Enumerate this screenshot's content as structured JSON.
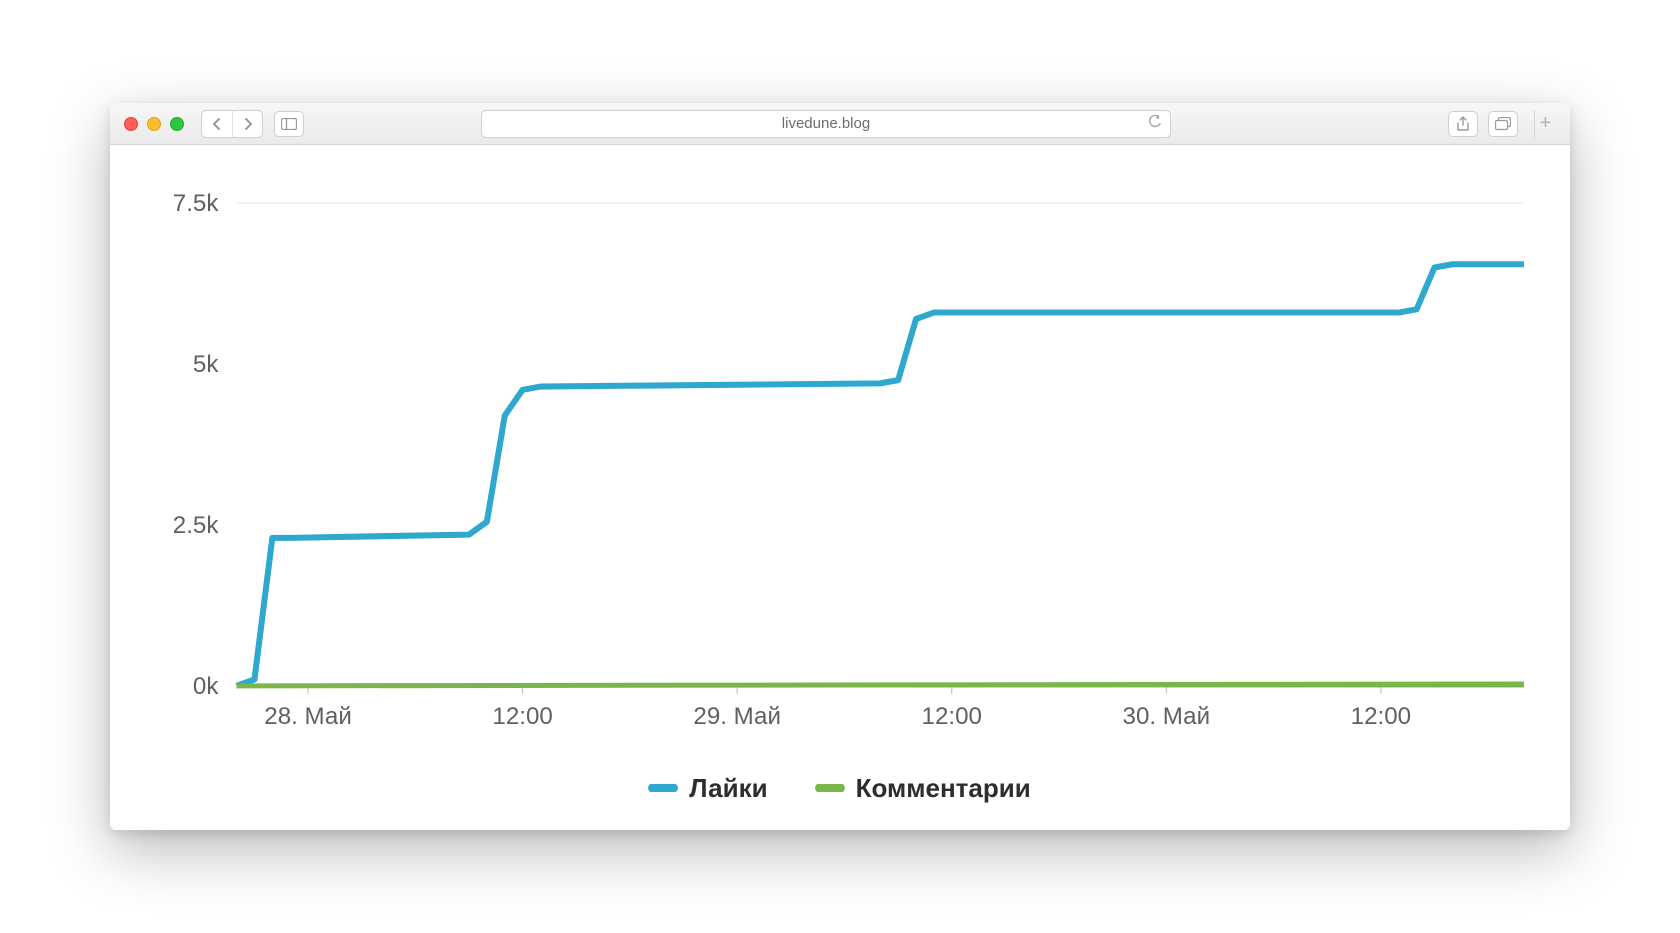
{
  "browser": {
    "address": "livedune.blog"
  },
  "chart_data": {
    "type": "line",
    "xlabel": "",
    "ylabel": "",
    "ylim": [
      0,
      7500
    ],
    "y_ticks": [
      0,
      2500,
      5000,
      7500
    ],
    "y_tick_labels": [
      "0k",
      "2.5k",
      "5k",
      "7.5k"
    ],
    "x_tick_labels": [
      "28. Май",
      "12:00",
      "29. Май",
      "12:00",
      "30. Май",
      "12:00"
    ],
    "x_tick_positions_hours": [
      4,
      16,
      28,
      40,
      52,
      64
    ],
    "x_range_hours": [
      0,
      72
    ],
    "series": [
      {
        "name": "Лайки",
        "color": "#2ea8cf",
        "points_hours_values": [
          [
            0,
            0
          ],
          [
            1,
            100
          ],
          [
            2,
            2300
          ],
          [
            3,
            2300
          ],
          [
            13,
            2350
          ],
          [
            14,
            2550
          ],
          [
            15,
            4200
          ],
          [
            16,
            4600
          ],
          [
            17,
            4650
          ],
          [
            36,
            4700
          ],
          [
            37,
            4750
          ],
          [
            38,
            5700
          ],
          [
            39,
            5800
          ],
          [
            65,
            5800
          ],
          [
            66,
            5850
          ],
          [
            67,
            6500
          ],
          [
            68,
            6550
          ],
          [
            72,
            6550
          ]
        ]
      },
      {
        "name": "Комментарии",
        "color": "#7ab648",
        "points_hours_values": [
          [
            0,
            0
          ],
          [
            72,
            30
          ]
        ]
      }
    ],
    "legend": [
      "Лайки",
      "Комментарии"
    ]
  }
}
